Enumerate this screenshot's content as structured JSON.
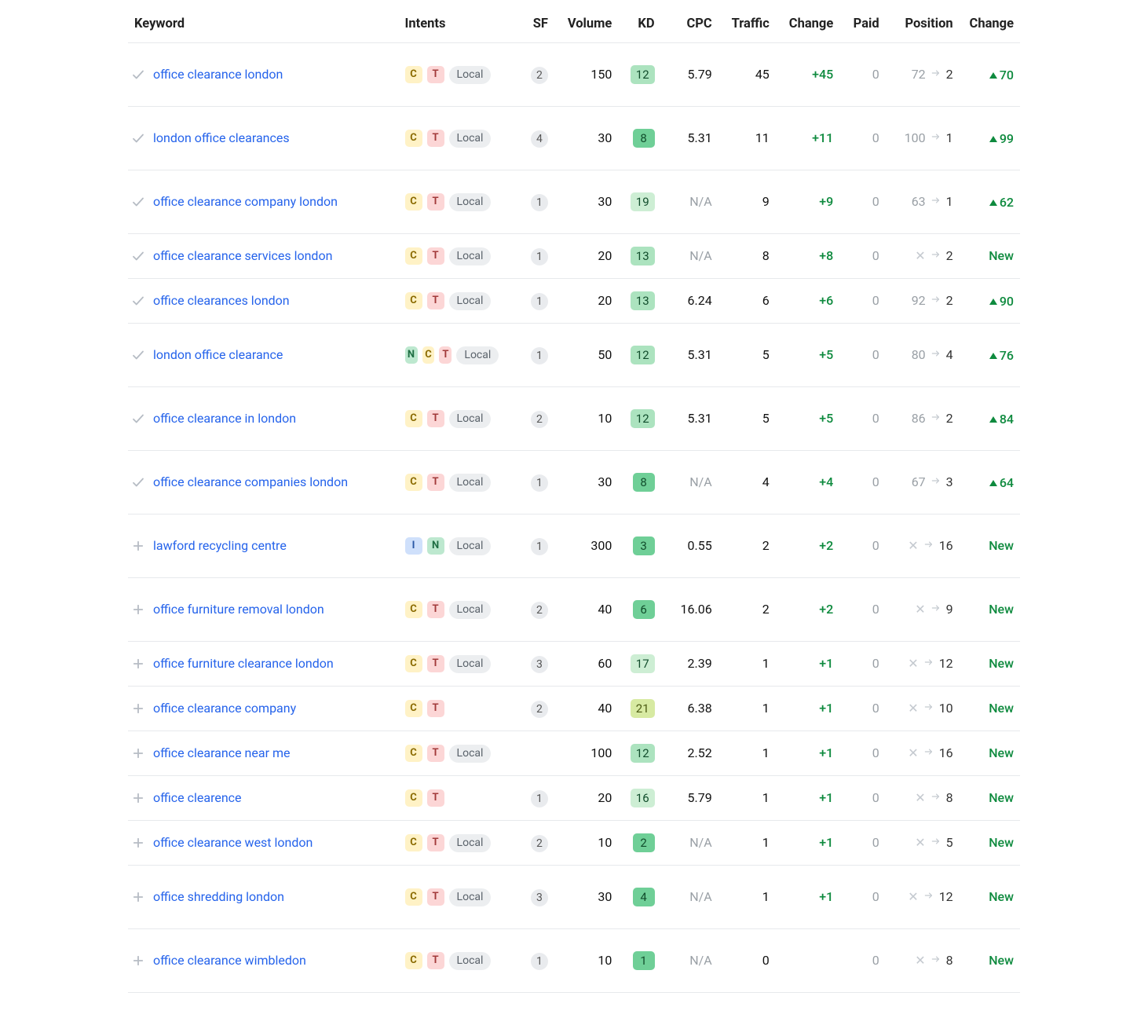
{
  "headers": {
    "keyword": "Keyword",
    "intents": "Intents",
    "sf": "SF",
    "volume": "Volume",
    "kd": "KD",
    "cpc": "CPC",
    "traffic": "Traffic",
    "traffic_change": "Change",
    "paid": "Paid",
    "position": "Position",
    "position_change": "Change"
  },
  "labels": {
    "local_chip": "Local",
    "new": "New",
    "intent_C": "C",
    "intent_T": "T",
    "intent_N": "N",
    "intent_I": "I"
  },
  "rows": [
    {
      "status": "check",
      "keyword": "office clearance london",
      "intents": [
        "C",
        "T"
      ],
      "local": true,
      "sf": "2",
      "volume": "150",
      "kd": "12",
      "kd_shade": "3",
      "cpc": "5.79",
      "traffic": "45",
      "traffic_change": "+45",
      "paid": "0",
      "pos_from": "72",
      "pos_to": "2",
      "pos_change": "70",
      "pos_new": false,
      "tall": true
    },
    {
      "status": "check",
      "keyword": "london office clearances",
      "intents": [
        "C",
        "T"
      ],
      "local": true,
      "sf": "4",
      "volume": "30",
      "kd": "8",
      "kd_shade": "1",
      "cpc": "5.31",
      "traffic": "11",
      "traffic_change": "+11",
      "paid": "0",
      "pos_from": "100",
      "pos_to": "1",
      "pos_change": "99",
      "pos_new": false,
      "tall": true
    },
    {
      "status": "check",
      "keyword": "office clearance company london",
      "intents": [
        "C",
        "T"
      ],
      "local": true,
      "sf": "1",
      "volume": "30",
      "kd": "19",
      "kd_shade": "4",
      "cpc": "N/A",
      "traffic": "9",
      "traffic_change": "+9",
      "paid": "0",
      "pos_from": "63",
      "pos_to": "1",
      "pos_change": "62",
      "pos_new": false,
      "tall": true
    },
    {
      "status": "check",
      "keyword": "office clearance services london",
      "intents": [
        "C",
        "T"
      ],
      "local": true,
      "sf": "1",
      "volume": "20",
      "kd": "13",
      "kd_shade": "3",
      "cpc": "N/A",
      "traffic": "8",
      "traffic_change": "+8",
      "paid": "0",
      "pos_from": "x",
      "pos_to": "2",
      "pos_change": "",
      "pos_new": true,
      "tall": false
    },
    {
      "status": "check",
      "keyword": "office clearances london",
      "intents": [
        "C",
        "T"
      ],
      "local": true,
      "sf": "1",
      "volume": "20",
      "kd": "13",
      "kd_shade": "3",
      "cpc": "6.24",
      "traffic": "6",
      "traffic_change": "+6",
      "paid": "0",
      "pos_from": "92",
      "pos_to": "2",
      "pos_change": "90",
      "pos_new": false,
      "tall": false
    },
    {
      "status": "check",
      "keyword": "london office clearance",
      "intents": [
        "N",
        "C",
        "T"
      ],
      "local": true,
      "sf": "1",
      "volume": "50",
      "kd": "12",
      "kd_shade": "3",
      "cpc": "5.31",
      "traffic": "5",
      "traffic_change": "+5",
      "paid": "0",
      "pos_from": "80",
      "pos_to": "4",
      "pos_change": "76",
      "pos_new": false,
      "tall": true
    },
    {
      "status": "check",
      "keyword": "office clearance in london",
      "intents": [
        "C",
        "T"
      ],
      "local": true,
      "sf": "2",
      "volume": "10",
      "kd": "12",
      "kd_shade": "3",
      "cpc": "5.31",
      "traffic": "5",
      "traffic_change": "+5",
      "paid": "0",
      "pos_from": "86",
      "pos_to": "2",
      "pos_change": "84",
      "pos_new": false,
      "tall": true
    },
    {
      "status": "check",
      "keyword": "office clearance companies london",
      "intents": [
        "C",
        "T"
      ],
      "local": true,
      "sf": "1",
      "volume": "30",
      "kd": "8",
      "kd_shade": "1",
      "cpc": "N/A",
      "traffic": "4",
      "traffic_change": "+4",
      "paid": "0",
      "pos_from": "67",
      "pos_to": "3",
      "pos_change": "64",
      "pos_new": false,
      "tall": true
    },
    {
      "status": "plus",
      "keyword": "lawford recycling centre",
      "intents": [
        "I",
        "N"
      ],
      "local": true,
      "sf": "1",
      "volume": "300",
      "kd": "3",
      "kd_shade": "1",
      "cpc": "0.55",
      "traffic": "2",
      "traffic_change": "+2",
      "paid": "0",
      "pos_from": "x",
      "pos_to": "16",
      "pos_change": "",
      "pos_new": true,
      "tall": true
    },
    {
      "status": "plus",
      "keyword": "office furniture removal london",
      "intents": [
        "C",
        "T"
      ],
      "local": true,
      "sf": "2",
      "volume": "40",
      "kd": "6",
      "kd_shade": "1",
      "cpc": "16.06",
      "traffic": "2",
      "traffic_change": "+2",
      "paid": "0",
      "pos_from": "x",
      "pos_to": "9",
      "pos_change": "",
      "pos_new": true,
      "tall": true
    },
    {
      "status": "plus",
      "keyword": "office furniture clearance london",
      "intents": [
        "C",
        "T"
      ],
      "local": true,
      "sf": "3",
      "volume": "60",
      "kd": "17",
      "kd_shade": "4",
      "cpc": "2.39",
      "traffic": "1",
      "traffic_change": "+1",
      "paid": "0",
      "pos_from": "x",
      "pos_to": "12",
      "pos_change": "",
      "pos_new": true,
      "tall": false
    },
    {
      "status": "plus",
      "keyword": "office clearance company",
      "intents": [
        "C",
        "T"
      ],
      "local": false,
      "sf": "2",
      "volume": "40",
      "kd": "21",
      "kd_shade": "y",
      "cpc": "6.38",
      "traffic": "1",
      "traffic_change": "+1",
      "paid": "0",
      "pos_from": "x",
      "pos_to": "10",
      "pos_change": "",
      "pos_new": true,
      "tall": false
    },
    {
      "status": "plus",
      "keyword": "office clearance near me",
      "intents": [
        "C",
        "T"
      ],
      "local": true,
      "sf": "",
      "volume": "100",
      "kd": "12",
      "kd_shade": "3",
      "cpc": "2.52",
      "traffic": "1",
      "traffic_change": "+1",
      "paid": "0",
      "pos_from": "x",
      "pos_to": "16",
      "pos_change": "",
      "pos_new": true,
      "tall": false
    },
    {
      "status": "plus",
      "keyword": "office clearence",
      "intents": [
        "C",
        "T"
      ],
      "local": false,
      "sf": "1",
      "volume": "20",
      "kd": "16",
      "kd_shade": "4",
      "cpc": "5.79",
      "traffic": "1",
      "traffic_change": "+1",
      "paid": "0",
      "pos_from": "x",
      "pos_to": "8",
      "pos_change": "",
      "pos_new": true,
      "tall": false
    },
    {
      "status": "plus",
      "keyword": "office clearance west london",
      "intents": [
        "C",
        "T"
      ],
      "local": true,
      "sf": "2",
      "volume": "10",
      "kd": "2",
      "kd_shade": "1",
      "cpc": "N/A",
      "traffic": "1",
      "traffic_change": "+1",
      "paid": "0",
      "pos_from": "x",
      "pos_to": "5",
      "pos_change": "",
      "pos_new": true,
      "tall": false
    },
    {
      "status": "plus",
      "keyword": "office shredding london",
      "intents": [
        "C",
        "T"
      ],
      "local": true,
      "sf": "3",
      "volume": "30",
      "kd": "4",
      "kd_shade": "1",
      "cpc": "N/A",
      "traffic": "1",
      "traffic_change": "+1",
      "paid": "0",
      "pos_from": "x",
      "pos_to": "12",
      "pos_change": "",
      "pos_new": true,
      "tall": true
    },
    {
      "status": "plus",
      "keyword": "office clearance wimbledon",
      "intents": [
        "C",
        "T"
      ],
      "local": true,
      "sf": "1",
      "volume": "10",
      "kd": "1",
      "kd_shade": "1",
      "cpc": "N/A",
      "traffic": "0",
      "traffic_change": "",
      "paid": "0",
      "pos_from": "x",
      "pos_to": "8",
      "pos_change": "",
      "pos_new": true,
      "tall": true
    }
  ]
}
